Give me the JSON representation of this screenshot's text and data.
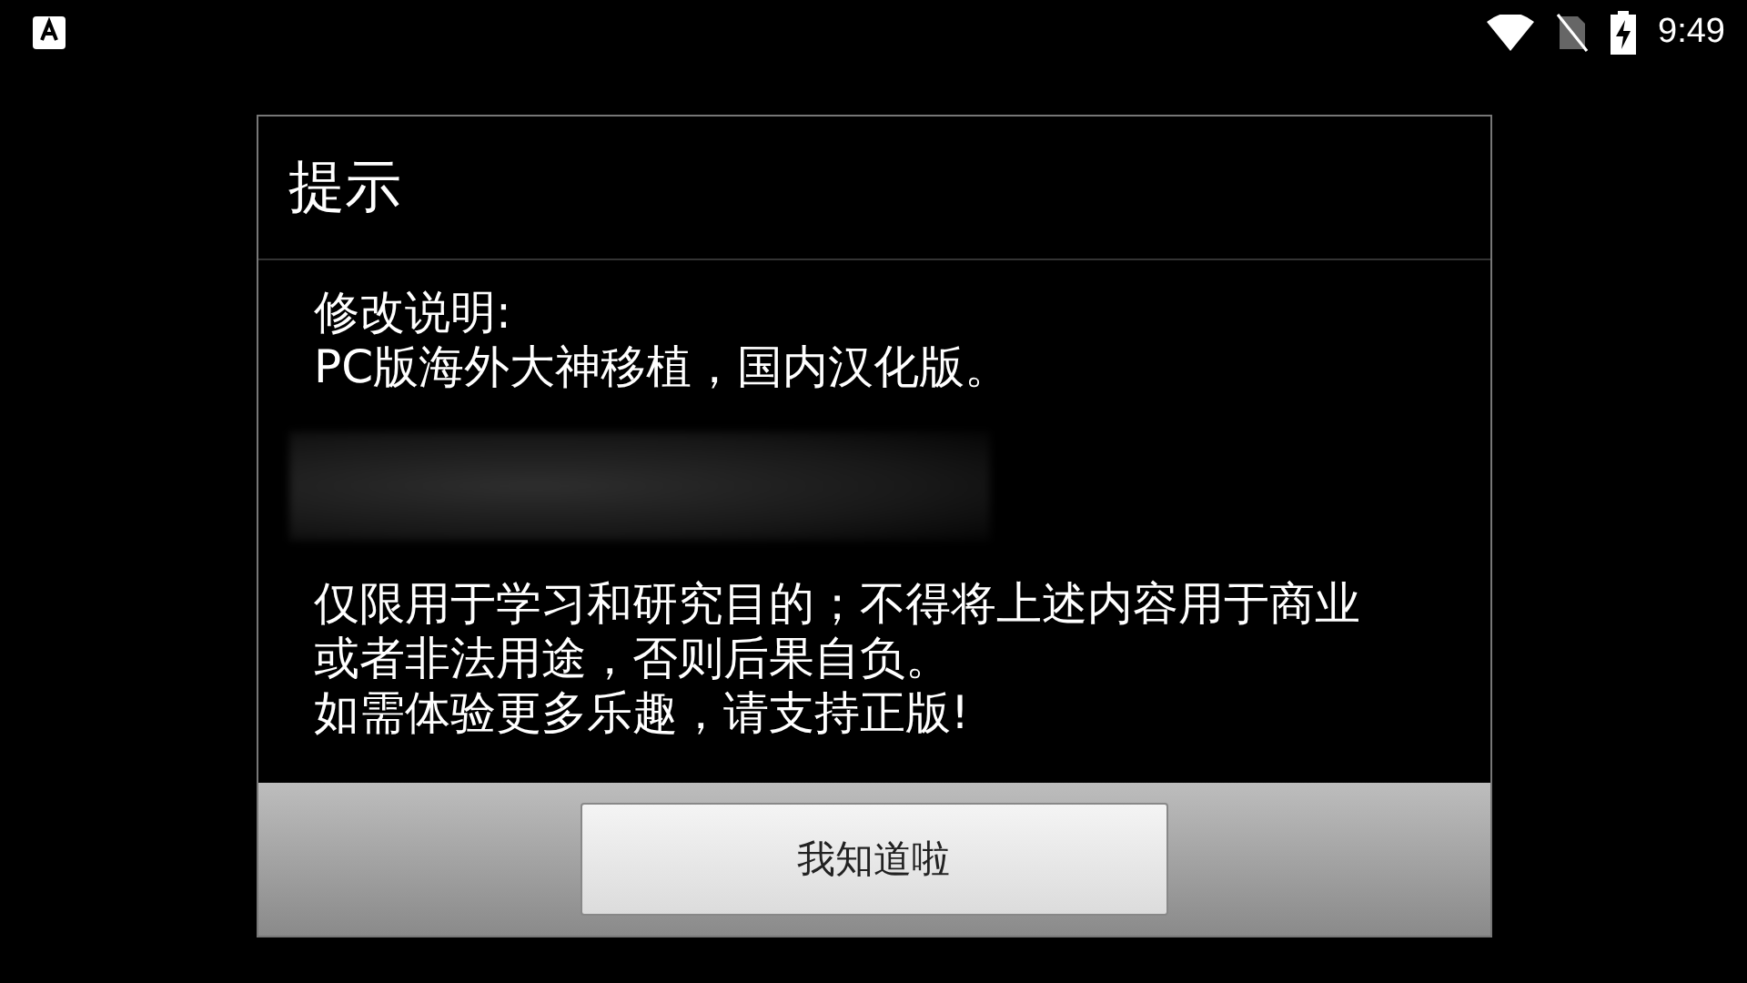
{
  "status_bar": {
    "time": "9:49"
  },
  "dialog": {
    "title": "提示",
    "intro_lines": [
      "修改说明:",
      "PC版海外大神移植，国内汉化版。"
    ],
    "notice_lines": [
      "仅限用于学习和研究目的；不得将上述内容用于商业",
      "或者非法用途，否则后果自负。",
      "如需体验更多乐趣，请支持正版!"
    ],
    "button": "我知道啦"
  }
}
